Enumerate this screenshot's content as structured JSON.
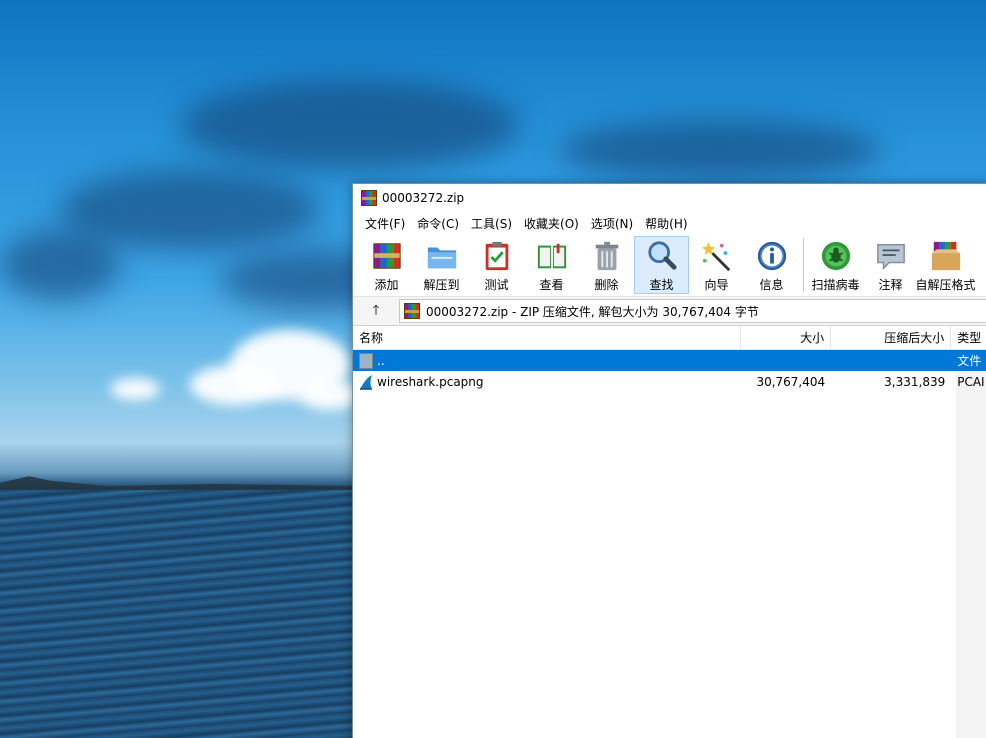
{
  "window": {
    "title": "00003272.zip"
  },
  "menu": [
    {
      "label": "文件(F)"
    },
    {
      "label": "命令(C)"
    },
    {
      "label": "工具(S)"
    },
    {
      "label": "收藏夹(O)"
    },
    {
      "label": "选项(N)"
    },
    {
      "label": "帮助(H)"
    }
  ],
  "toolbar": [
    {
      "label": "添加",
      "icon": "add-archive-icon"
    },
    {
      "label": "解压到",
      "icon": "extract-folder-icon"
    },
    {
      "label": "测试",
      "icon": "test-clipboard-icon"
    },
    {
      "label": "查看",
      "icon": "view-book-icon"
    },
    {
      "label": "删除",
      "icon": "trash-icon"
    },
    {
      "label": "查找",
      "icon": "magnifier-icon"
    },
    {
      "label": "向导",
      "icon": "wizard-wand-icon"
    },
    {
      "label": "信息",
      "icon": "info-icon"
    },
    {
      "label": "扫描病毒",
      "icon": "virus-scan-icon"
    },
    {
      "label": "注释",
      "icon": "comment-icon"
    },
    {
      "label": "自解压格式",
      "icon": "sfx-box-icon"
    }
  ],
  "address": {
    "up_glyph": "↑",
    "text": "00003272.zip - ZIP 压缩文件, 解包大小为 30,767,404 字节"
  },
  "columns": {
    "name": "名称",
    "size": "大小",
    "packed": "压缩后大小",
    "type": "类型"
  },
  "rows": [
    {
      "name": "..",
      "size": "",
      "packed": "",
      "type": "文件",
      "selected": true
    },
    {
      "name": "wireshark.pcapng",
      "size": "30,767,404",
      "packed": "3,331,839",
      "type": "PCAI",
      "selected": false
    }
  ],
  "colors": {
    "selection": "#0078d7",
    "active_tool": "#dcecfc"
  }
}
